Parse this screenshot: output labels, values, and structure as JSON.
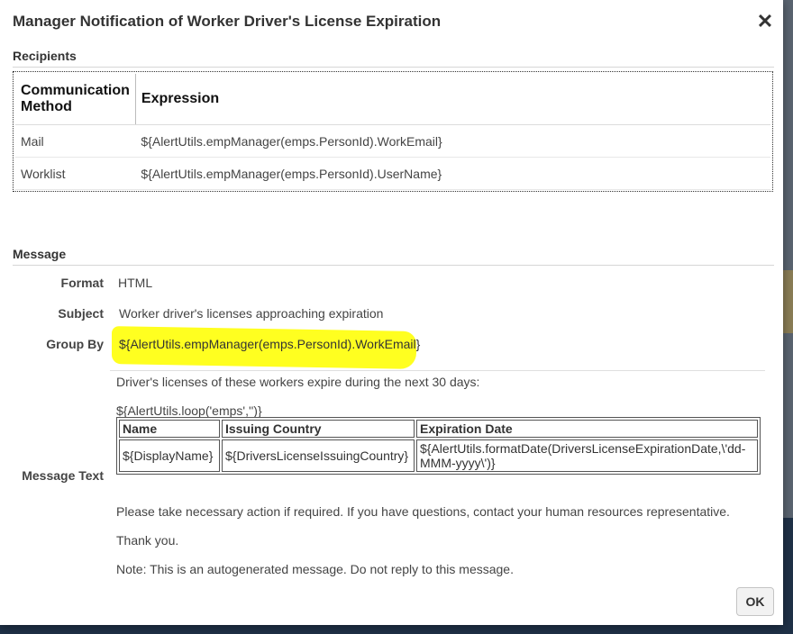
{
  "dialog": {
    "title": "Manager Notification of Worker Driver's License Expiration",
    "close_glyph": "✕",
    "ok_label": "OK"
  },
  "recipients": {
    "section_title": "Recipients",
    "headers": {
      "method": "Communication Method",
      "expression": "Expression"
    },
    "rows": [
      {
        "method": "Mail",
        "expression": "${AlertUtils.empManager(emps.PersonId).WorkEmail}"
      },
      {
        "method": "Worklist",
        "expression": "${AlertUtils.empManager(emps.PersonId).UserName}"
      }
    ]
  },
  "message": {
    "section_title": "Message",
    "format_label": "Format",
    "format_value": "HTML",
    "subject_label": "Subject",
    "subject_value": "Worker driver's licenses approaching expiration",
    "group_by_label": "Group By",
    "group_by_value": "${AlertUtils.empManager(emps.PersonId).WorkEmail}",
    "highlight_color": "#ffff20",
    "text_label": "Message Text",
    "intro": "Driver's licenses of these workers expire during the next 30 days:",
    "loop": "${AlertUtils.loop('emps','')}",
    "table": {
      "headers": [
        "Name",
        "Issuing Country",
        "Expiration Date"
      ],
      "row": [
        "${DisplayName}",
        "${DriversLicenseIssuingCountry}",
        "${AlertUtils.formatDate(DriversLicenseExpirationDate,\\'dd-MMM-yyyy\\')}"
      ]
    },
    "action": "Please take necessary action if required. If you have questions, contact your human resources representative.",
    "thanks": "Thank you.",
    "note": "Note: This is an autogenerated message. Do not reply to this message."
  }
}
